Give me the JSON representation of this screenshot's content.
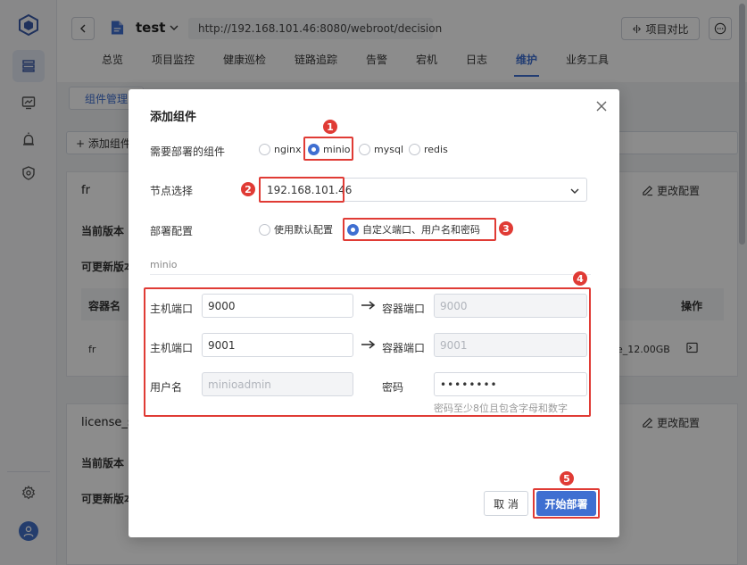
{
  "header": {
    "project_name": "test",
    "url": "http://192.168.101.46:8080/webroot/decision",
    "compare_button": "项目对比",
    "tabs": [
      "总览",
      "项目监控",
      "健康巡检",
      "链路追踪",
      "告警",
      "宕机",
      "日志",
      "维护",
      "业务工具"
    ],
    "active_tab": "维护"
  },
  "page": {
    "sub_tab": "组件管理",
    "add_button": "+ 添加组件",
    "card1": {
      "title": "fr",
      "current_version_label": "当前版本",
      "updatable_label": "可更新版本",
      "edit_button": "更改配置",
      "col_container": "容器名",
      "col_ops": "操作",
      "row_name": "fr",
      "row_value": "e_12.00GB"
    },
    "card2": {
      "title": "license_s",
      "current_version_label": "当前版本",
      "updatable_label": "可更新版本",
      "edit_button": "更改配置"
    }
  },
  "modal": {
    "title": "添加组件",
    "component_label": "需要部署的组件",
    "components": [
      "nginx",
      "minio",
      "mysql",
      "redis"
    ],
    "selected_component": "minio",
    "node_label": "节点选择",
    "node_value": "192.168.101.46",
    "config_label": "部署配置",
    "config_default": "使用默认配置",
    "config_custom": "自定义端口、用户名和密码",
    "selected_config": "custom",
    "section_name": "minio",
    "host_port_label": "主机端口",
    "container_port_label": "容器端口",
    "host_port_1": "9000",
    "container_port_1": "9000",
    "host_port_2": "9001",
    "container_port_2": "9001",
    "username_label": "用户名",
    "username_placeholder": "minioadmin",
    "password_label": "密码",
    "password_value": "••••••••",
    "password_hint": "密码至少8位且包含字母和数字",
    "cancel_button": "取 消",
    "deploy_button": "开始部署"
  },
  "annotations": [
    "1",
    "2",
    "3",
    "4",
    "5"
  ],
  "colors": {
    "accent": "#3f6fd1",
    "annotation_red": "#e03b35"
  }
}
